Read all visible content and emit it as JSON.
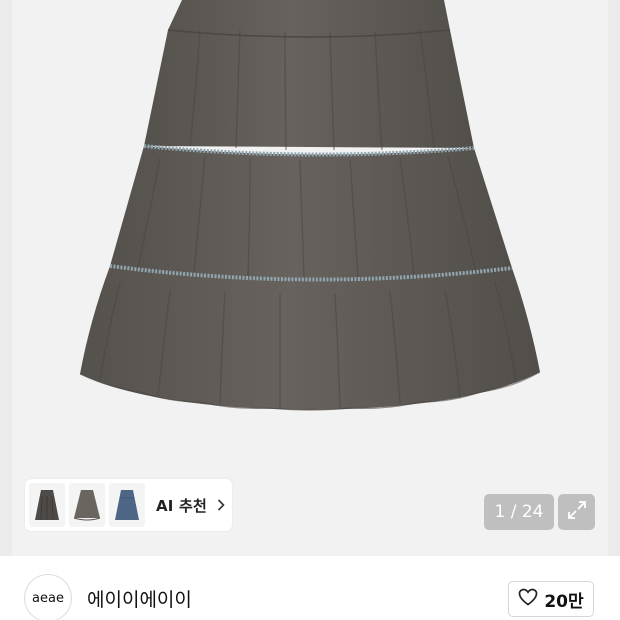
{
  "gallery": {
    "image_alt": "product-skirt-photo",
    "ai_recommend": {
      "label": "AI 추천",
      "thumbnails": [
        "thumb-dark-skirt-icon",
        "thumb-gray-skirt-icon",
        "thumb-denim-skirt-icon"
      ]
    },
    "counter": {
      "text": "1 / 24"
    },
    "expand_icon": "expand-icon"
  },
  "shop": {
    "logo_text": "aeae",
    "name": "에이이에이이",
    "like_count": "20만",
    "like_icon": "heart-icon"
  },
  "colors": {
    "hero_bg": "#f2f2f2",
    "skirt": "#5f5b57",
    "trim": "#8fa6b0"
  }
}
